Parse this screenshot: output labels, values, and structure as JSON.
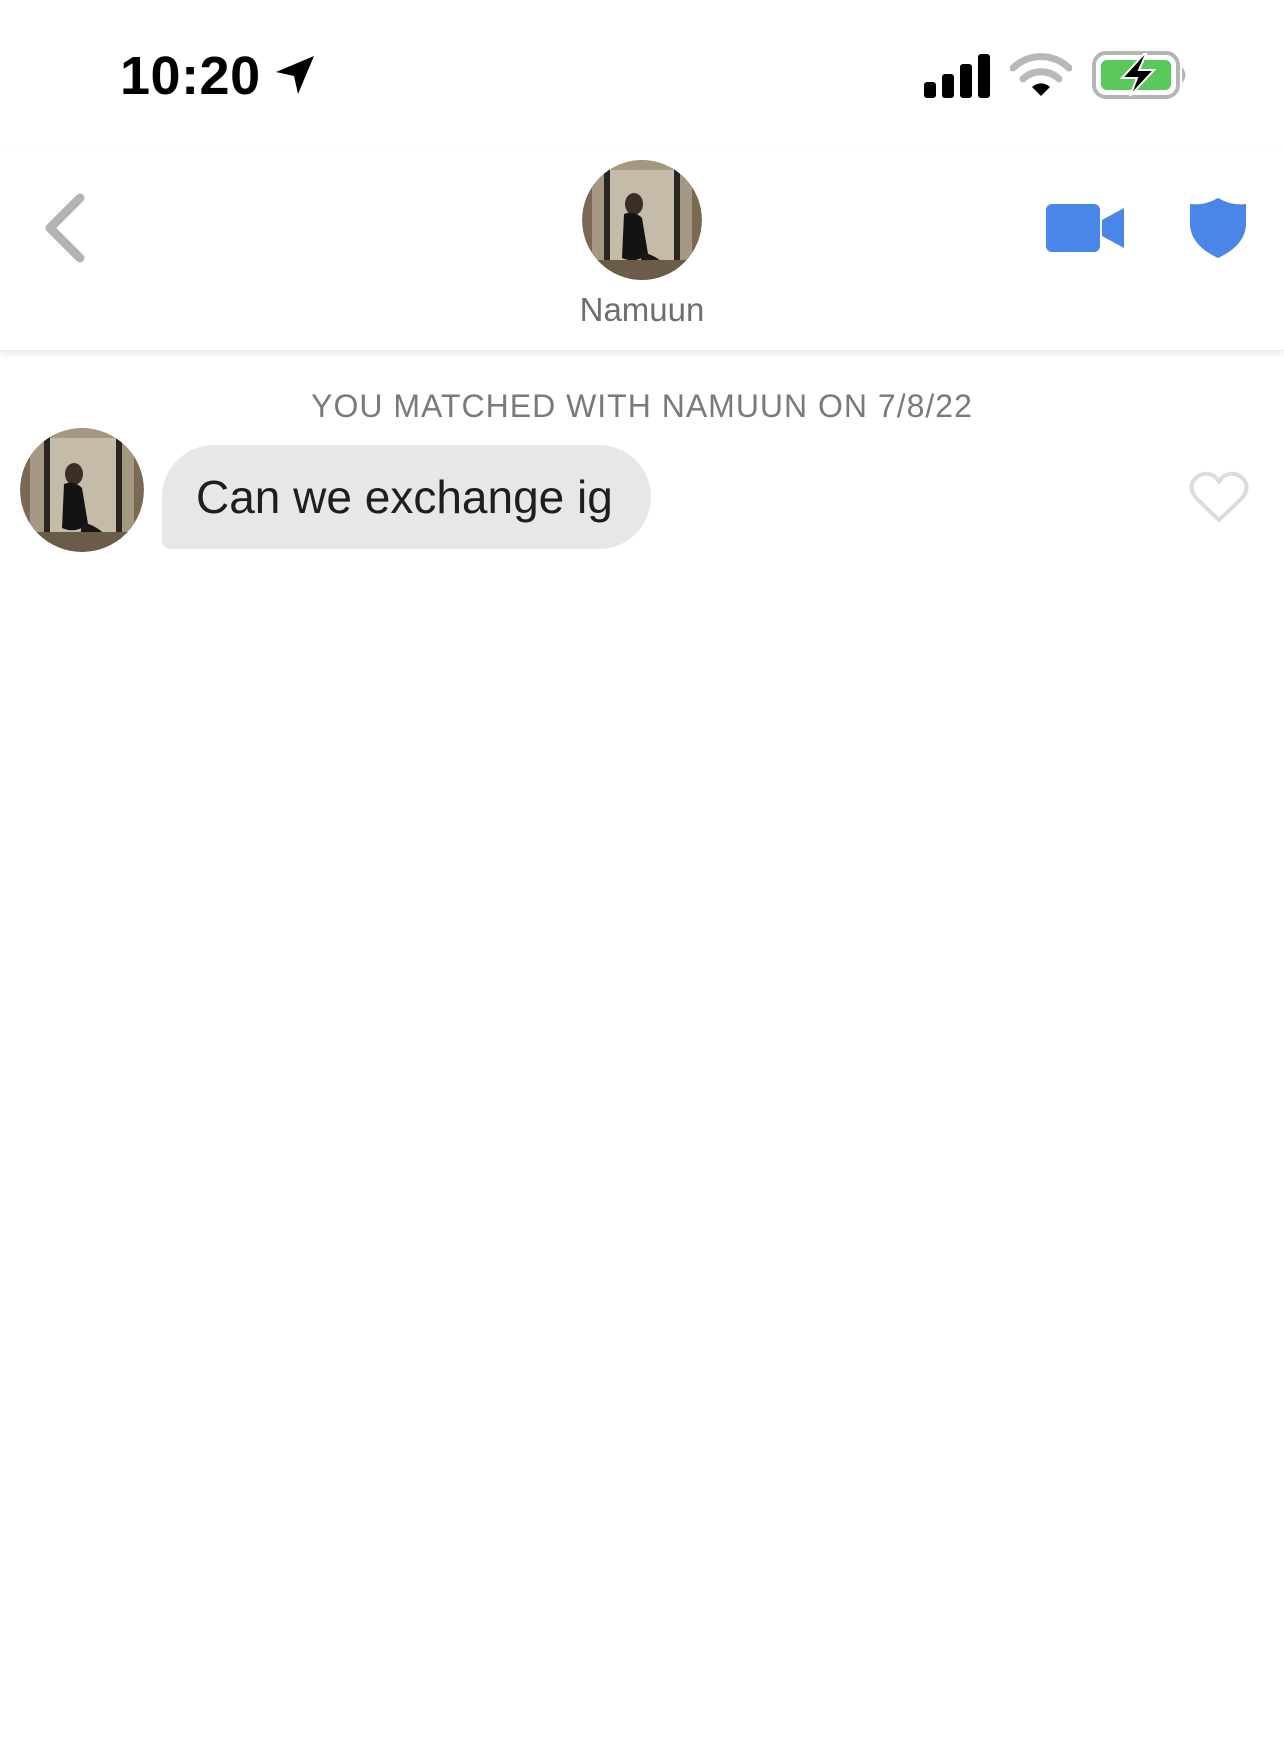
{
  "status_bar": {
    "time": "10:20",
    "location_icon": "location-arrow-icon",
    "signal_icon": "cellular-signal-icon",
    "wifi_icon": "wifi-icon",
    "battery_icon": "battery-charging-icon",
    "battery_color": "#5ac85a"
  },
  "header": {
    "back_icon": "chevron-left-icon",
    "contact_name": "Namuun",
    "video_icon": "video-camera-icon",
    "safety_icon": "shield-icon",
    "accent_color": "#4a86e8"
  },
  "conversation": {
    "match_notice": "YOU MATCHED WITH NAMUUN ON 7/8/22",
    "messages": [
      {
        "text": "Can we exchange ig",
        "like_icon": "heart-outline-icon"
      }
    ]
  }
}
